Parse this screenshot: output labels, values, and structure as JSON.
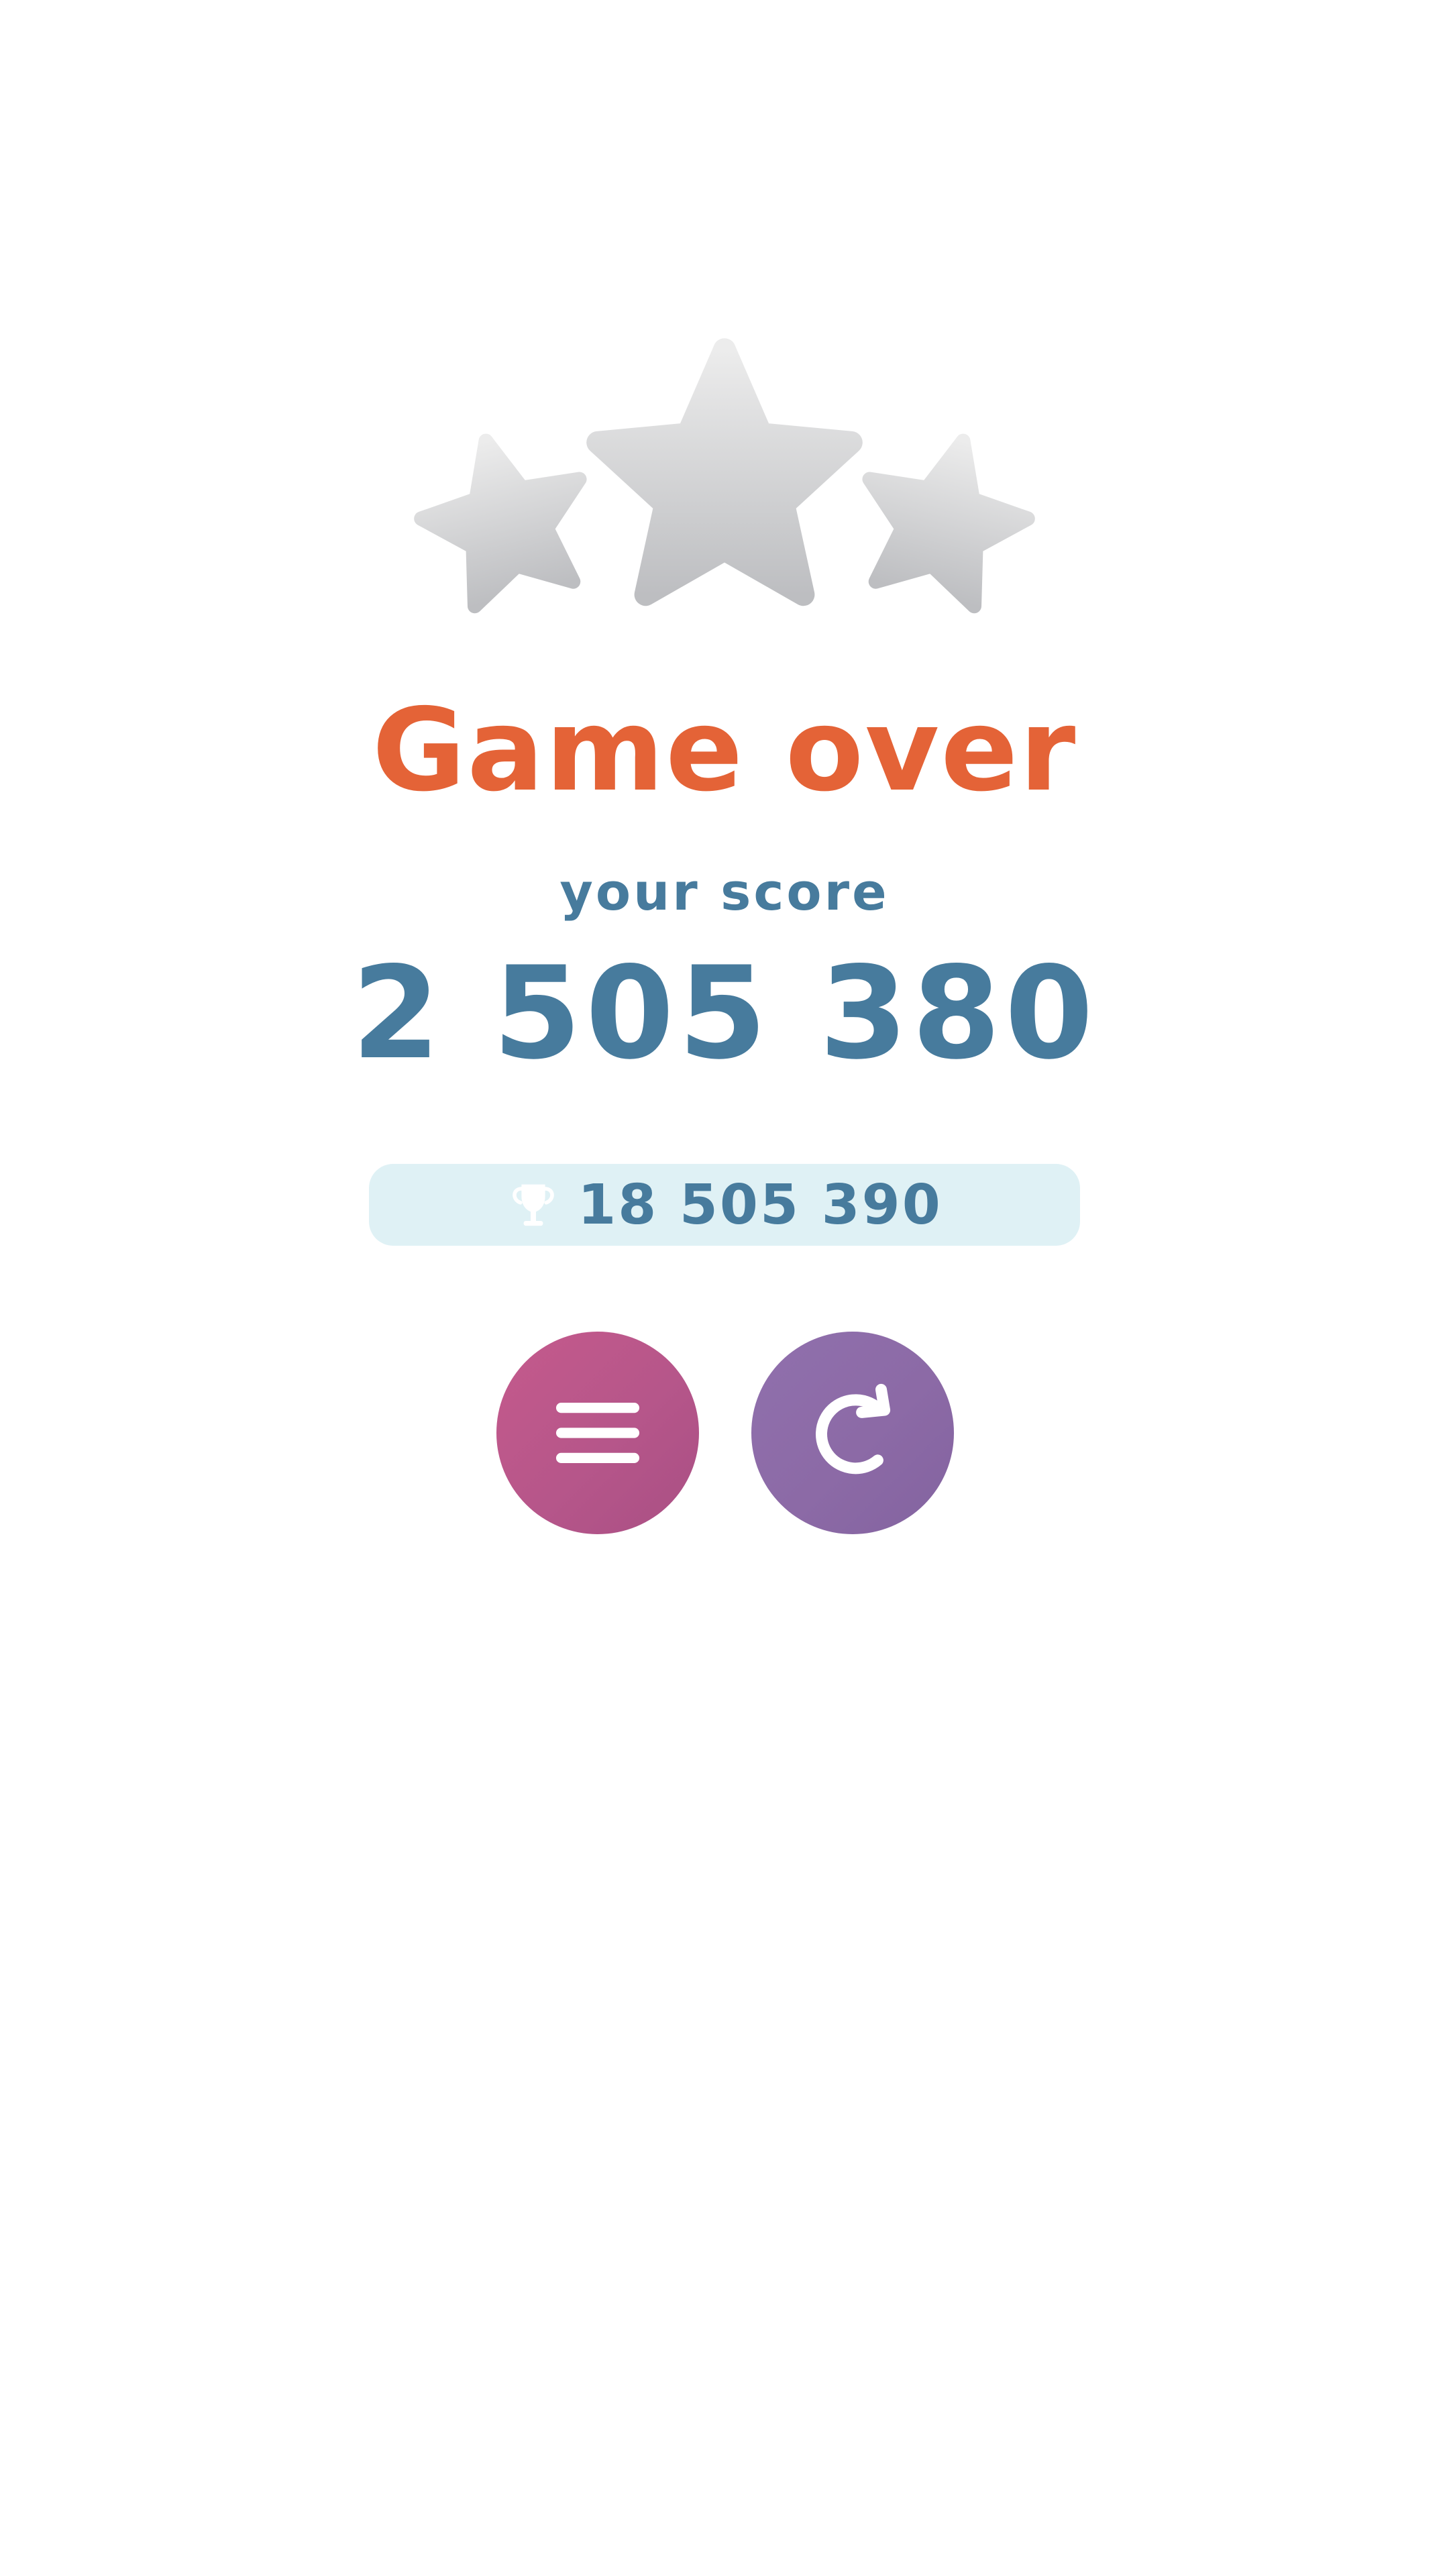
{
  "game": {
    "title": "Game over",
    "score_label": "your score",
    "score": "2 505 380",
    "best_score": "18 505 390",
    "stars_earned": 0,
    "stars_total": 3
  },
  "icons": {
    "best": "trophy-icon",
    "menu_button": "menu-icon",
    "restart_button": "restart-icon",
    "stars": "star-icon"
  },
  "colors": {
    "title": "#e46337",
    "score_text": "#477b9d",
    "best_bar_bg": "#dff1f5",
    "menu_button": "#b6568a",
    "restart_button": "#8c6aa6",
    "star_empty_top": "#ececec",
    "star_empty_bottom": "#bdbec1",
    "icon": "#ffffff"
  }
}
